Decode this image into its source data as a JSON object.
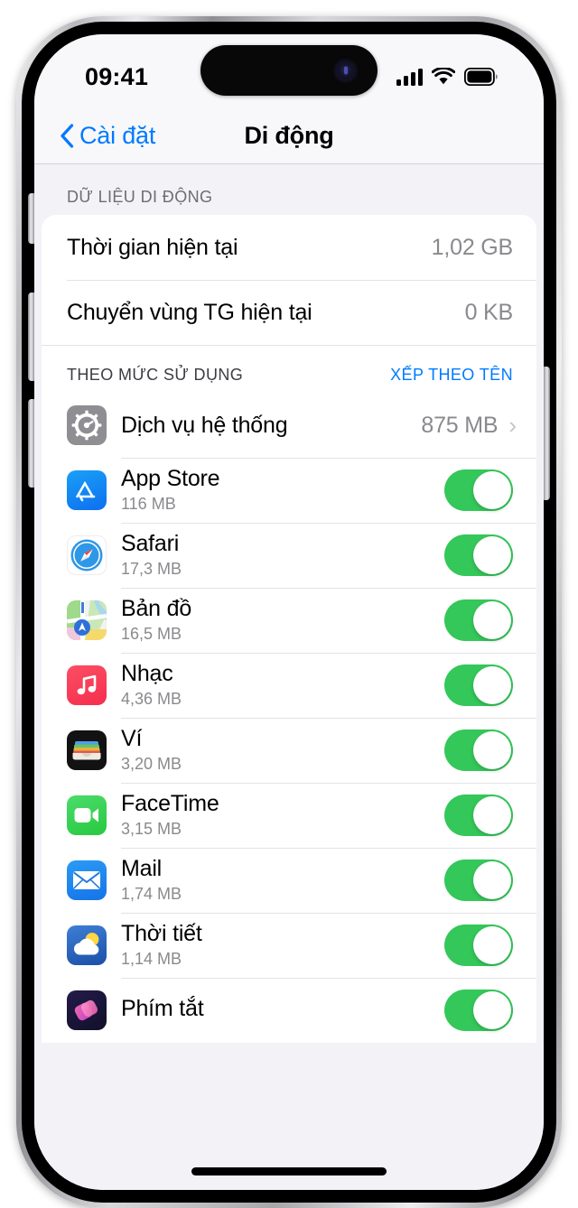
{
  "status_bar": {
    "time": "09:41",
    "signal_icon": "cellular-signal-icon",
    "wifi_icon": "wifi-icon",
    "battery_icon": "battery-full-icon"
  },
  "nav": {
    "back_label": "Cài đặt",
    "back_icon": "chevron-left-icon",
    "title": "Di động"
  },
  "section_header": "DỮ LIỆU DI ĐỘNG",
  "usage_rows": [
    {
      "title": "Thời gian hiện tại",
      "value": "1,02 GB"
    },
    {
      "title": "Chuyển vùng TG hiện tại",
      "value": "0 KB"
    }
  ],
  "sort_bar": {
    "label": "THEO MỨC SỬ DỤNG",
    "action": "XẾP THEO TÊN"
  },
  "system_services": {
    "icon": "gear-icon",
    "name": "Dịch vụ hệ thống",
    "value": "875 MB",
    "chevron": "›"
  },
  "apps": [
    {
      "icon": "app-store-icon",
      "name": "App Store",
      "size": "116 MB",
      "toggle": "on"
    },
    {
      "icon": "safari-icon",
      "name": "Safari",
      "size": "17,3 MB",
      "toggle": "on"
    },
    {
      "icon": "maps-icon",
      "name": "Bản đồ",
      "size": "16,5 MB",
      "toggle": "on"
    },
    {
      "icon": "music-icon",
      "name": "Nhạc",
      "size": "4,36 MB",
      "toggle": "on"
    },
    {
      "icon": "wallet-icon",
      "name": "Ví",
      "size": "3,20 MB",
      "toggle": "on"
    },
    {
      "icon": "facetime-icon",
      "name": "FaceTime",
      "size": "3,15 MB",
      "toggle": "on"
    },
    {
      "icon": "mail-icon",
      "name": "Mail",
      "size": "1,74 MB",
      "toggle": "on"
    },
    {
      "icon": "weather-icon",
      "name": "Thời tiết",
      "size": "1,14 MB",
      "toggle": "on"
    },
    {
      "icon": "shortcuts-icon",
      "name": "Phím tắt",
      "size": "",
      "toggle": "on"
    }
  ],
  "colors": {
    "accent_blue": "#007aff",
    "toggle_green": "#34c759",
    "background": "#f2f2f7",
    "secondary_text": "#8a8a8e"
  }
}
